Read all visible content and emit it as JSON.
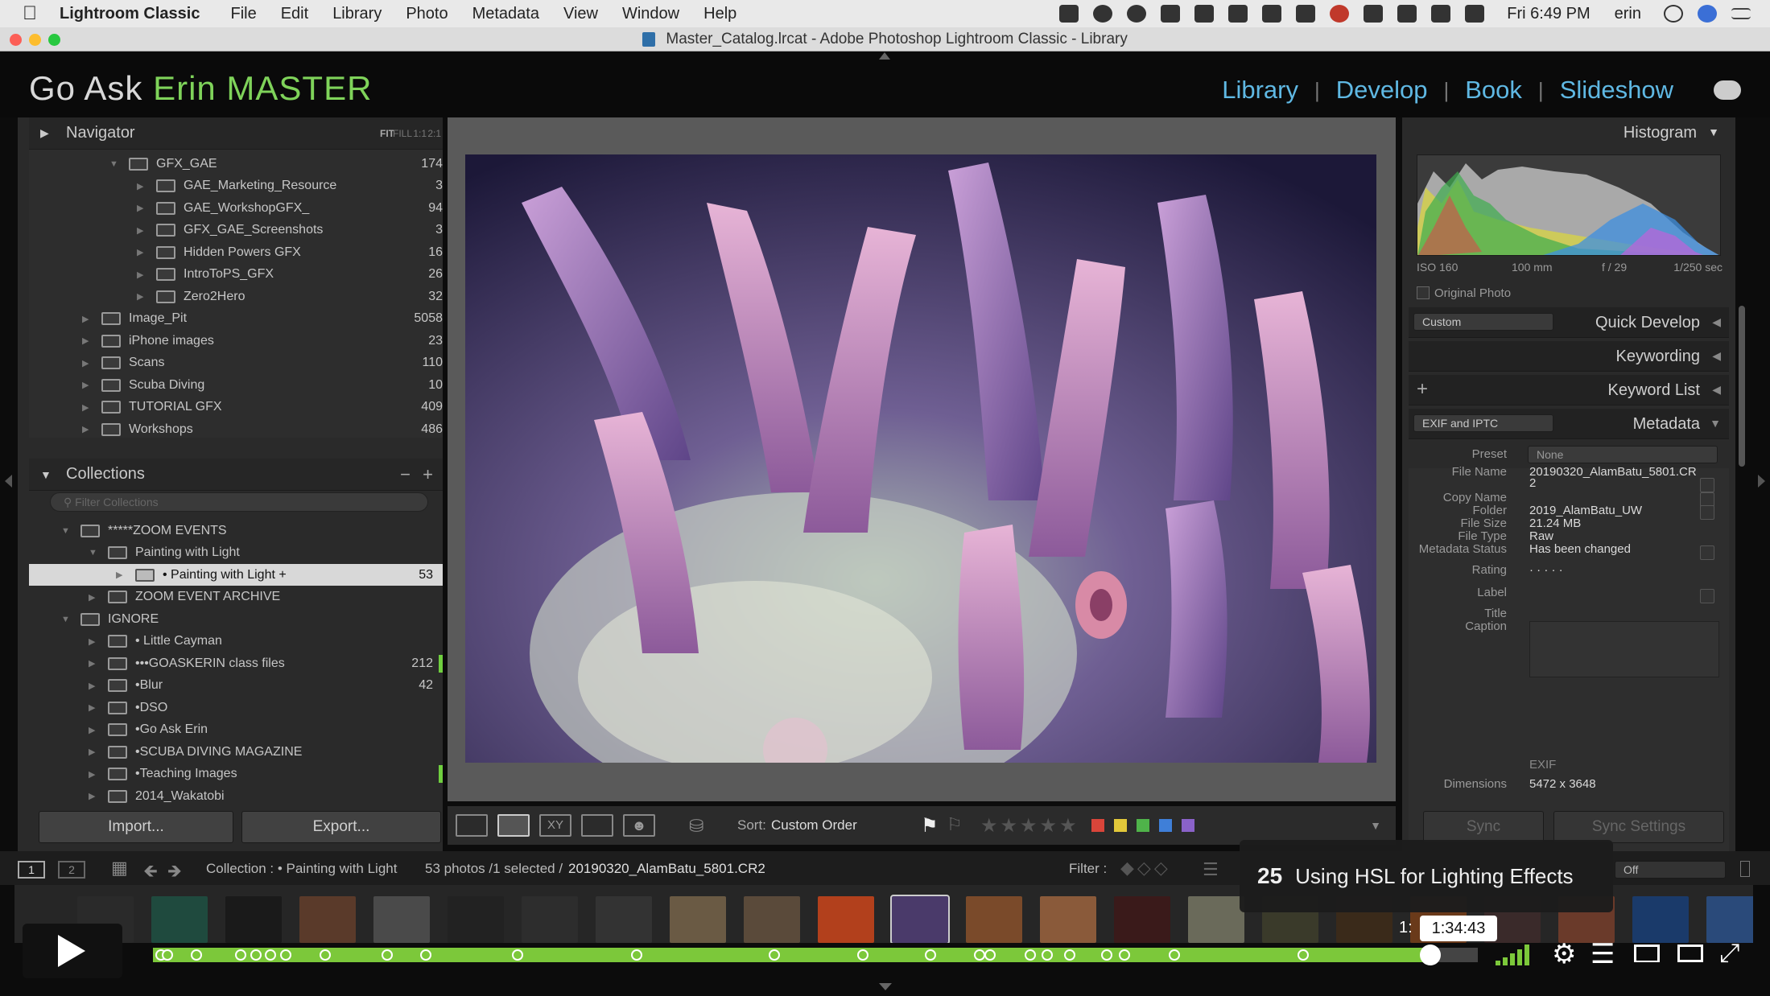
{
  "menubar": {
    "app": "Lightroom Classic",
    "items": [
      "File",
      "Edit",
      "Library",
      "Photo",
      "Metadata",
      "View",
      "Window",
      "Help"
    ],
    "clock": "Fri 6:49 PM",
    "user": "erin"
  },
  "window_title": "Master_Catalog.lrcat - Adobe Photoshop Lightroom Classic - Library",
  "header": {
    "brand_prefix": "Go Ask ",
    "brand_highlight": "Erin MASTER",
    "modules": [
      "Library",
      "Develop",
      "Book",
      "Slideshow"
    ]
  },
  "navigator": {
    "title": "Navigator",
    "zoom_options": [
      "FIT",
      "FILL",
      "1:1",
      "2:1"
    ]
  },
  "folders": [
    {
      "name": "GFX_GAE",
      "count": "174",
      "level": 1,
      "expanded": true
    },
    {
      "name": "GAE_Marketing_Resource",
      "count": "3",
      "level": 2
    },
    {
      "name": "GAE_WorkshopGFX_",
      "count": "94",
      "level": 2
    },
    {
      "name": "GFX_GAE_Screenshots",
      "count": "3",
      "level": 2
    },
    {
      "name": "Hidden Powers GFX",
      "count": "16",
      "level": 2
    },
    {
      "name": "IntroToPS_GFX",
      "count": "26",
      "level": 2
    },
    {
      "name": "Zero2Hero",
      "count": "32",
      "level": 2
    },
    {
      "name": "Image_Pit",
      "count": "5058",
      "level": 0
    },
    {
      "name": "iPhone images",
      "count": "23",
      "level": 0
    },
    {
      "name": "Scans",
      "count": "110",
      "level": 0
    },
    {
      "name": "Scuba Diving",
      "count": "10",
      "level": 0
    },
    {
      "name": "TUTORIAL GFX",
      "count": "409",
      "level": 0
    },
    {
      "name": "Workshops",
      "count": "486",
      "level": 0
    }
  ],
  "collections": {
    "title": "Collections",
    "filter_placeholder": "Filter Collections",
    "items": [
      {
        "name": "*****ZOOM EVENTS",
        "count": "",
        "level": 0,
        "expanded": true
      },
      {
        "name": "Painting with Light",
        "count": "",
        "level": 1,
        "expanded": true
      },
      {
        "name": "• Painting with Light  +",
        "count": "53",
        "level": 2,
        "selected": true
      },
      {
        "name": "ZOOM EVENT ARCHIVE",
        "count": "",
        "level": 1
      },
      {
        "name": "IGNORE",
        "count": "",
        "level": 0,
        "expanded": true
      },
      {
        "name": "• Little Cayman",
        "count": "",
        "level": 1
      },
      {
        "name": "•••GOASKERIN class files",
        "count": "212",
        "level": 1,
        "mark": true
      },
      {
        "name": "•Blur",
        "count": "42",
        "level": 1
      },
      {
        "name": "•DSO",
        "count": "",
        "level": 1
      },
      {
        "name": "•Go Ask Erin",
        "count": "",
        "level": 1
      },
      {
        "name": "•SCUBA DIVING MAGAZINE",
        "count": "",
        "level": 1
      },
      {
        "name": "•Teaching Images",
        "count": "",
        "level": 1,
        "mark": true
      },
      {
        "name": "2014_Wakatobi",
        "count": "",
        "level": 1
      }
    ]
  },
  "left_buttons": {
    "import": "Import...",
    "export": "Export..."
  },
  "toolbar": {
    "sort_label": "Sort:",
    "sort_value": "Custom Order"
  },
  "histogram": {
    "title": "Histogram",
    "iso": "ISO 160",
    "focal": "100 mm",
    "aperture": "f / 29",
    "shutter": "1/250 sec",
    "original_photo": "Original Photo"
  },
  "quick_develop": {
    "preset": "Custom",
    "title": "Quick Develop"
  },
  "keywording": {
    "title": "Keywording"
  },
  "keyword_list": {
    "title": "Keyword List"
  },
  "metadata": {
    "preset_combo": "EXIF and IPTC",
    "title": "Metadata",
    "preset_label": "Preset",
    "preset_value": "None",
    "fields": [
      {
        "k": "File Name",
        "v": "20190320_AlamBatu_5801.CR"
      },
      {
        "k": "",
        "v": "2"
      },
      {
        "k": "Copy Name",
        "v": ""
      },
      {
        "k": "Folder",
        "v": "2019_AlamBatu_UW"
      },
      {
        "k": "File Size",
        "v": "21.24 MB"
      },
      {
        "k": "File Type",
        "v": "Raw"
      },
      {
        "k": "Metadata Status",
        "v": "Has been changed"
      },
      {
        "k": "Rating",
        "v": "·  ·  ·  ·  ·"
      },
      {
        "k": "Label",
        "v": ""
      },
      {
        "k": "Title",
        "v": ""
      },
      {
        "k": "Caption",
        "v": ""
      }
    ],
    "exif_label": "EXIF",
    "dimensions_label": "Dimensions",
    "dimensions_value": "5472 x 3648"
  },
  "sync": {
    "sync": "Sync",
    "sync_settings": "Sync Settings"
  },
  "filmbar": {
    "screen1": "1",
    "screen2": "2",
    "source": "Collection : • Painting with Light",
    "count": "53 photos /1 selected /",
    "filename": "20190320_AlamBatu_5801.CR2",
    "filter_label": "Filter :",
    "filter_value": "Off"
  },
  "video": {
    "chapter_number": "25",
    "chapter_title": "Using HSL for Lighting Effects",
    "time": "1:34:43",
    "time_prefix": "1:",
    "progress": 0.964,
    "cues": [
      0.006,
      0.011,
      0.033,
      0.066,
      0.078,
      0.089,
      0.1,
      0.13,
      0.177,
      0.206,
      0.275,
      0.365,
      0.469,
      0.536,
      0.587,
      0.624,
      0.632,
      0.662,
      0.675,
      0.692,
      0.72,
      0.733,
      0.771,
      0.868
    ]
  },
  "colors": {
    "accent_green": "#7fd35a",
    "module_blue": "#5fb8e3",
    "progress_green": "#7cc83a"
  }
}
